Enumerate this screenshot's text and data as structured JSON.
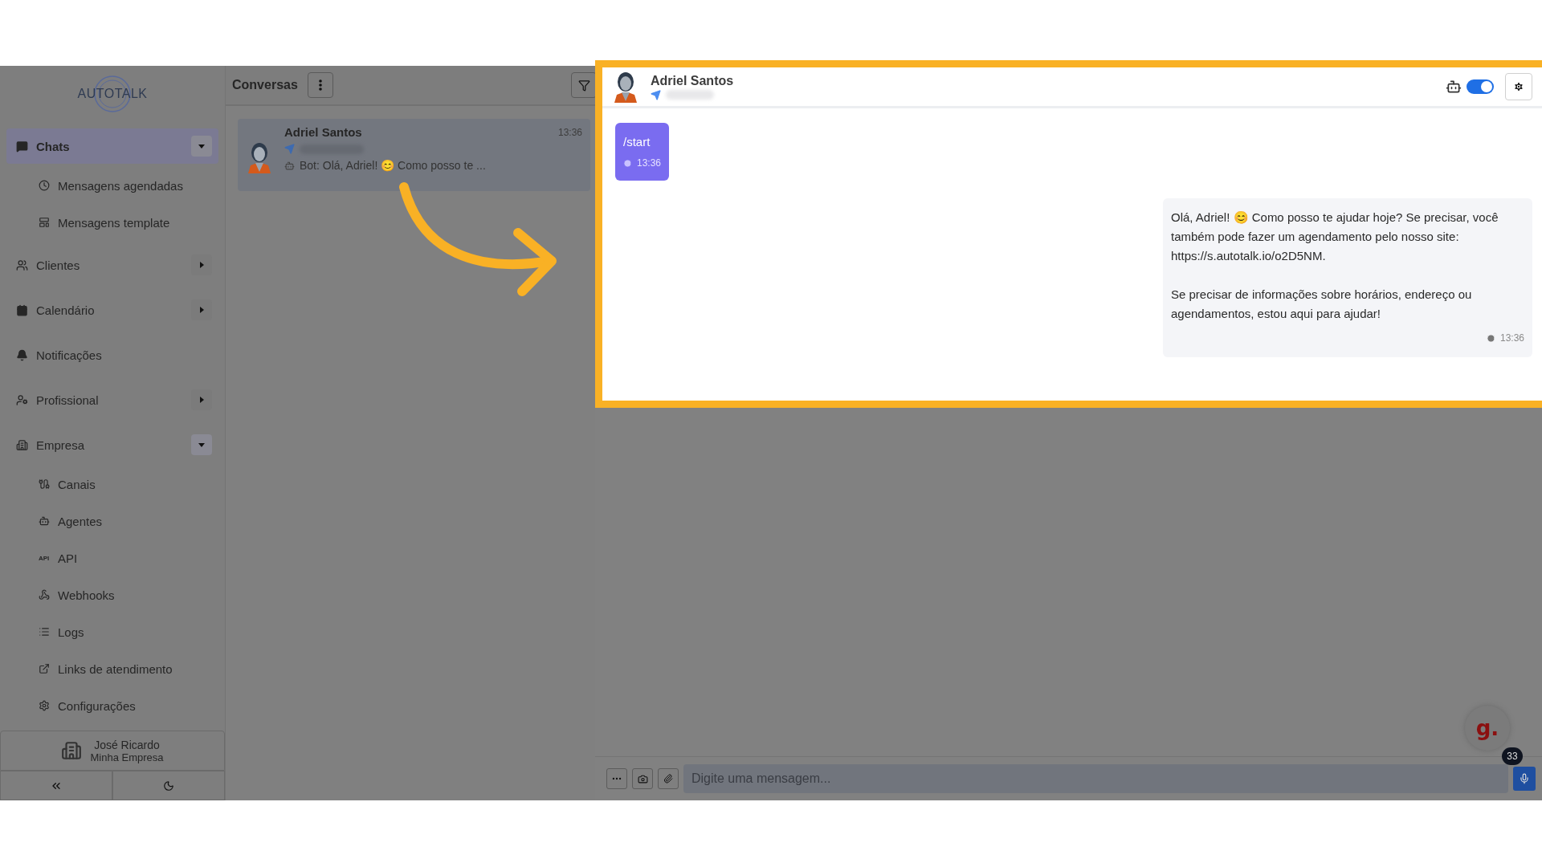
{
  "sidebar": {
    "logo": "AUTOTALK",
    "items": [
      {
        "label": "Chats",
        "selected": true,
        "expanded": true,
        "children": [
          {
            "label": "Mensagens agendadas",
            "selected": false
          },
          {
            "label": "Mensagens template",
            "selected": false
          }
        ]
      },
      {
        "label": "Clientes",
        "selected": false,
        "expanded": false
      },
      {
        "label": "Calendário",
        "selected": false,
        "expanded": false
      },
      {
        "label": "Notificações",
        "selected": false
      },
      {
        "label": "Profissional",
        "selected": false,
        "expanded": false
      },
      {
        "label": "Empresa",
        "selected": false,
        "expanded": true,
        "children": [
          {
            "label": "Canais",
            "selected": false
          },
          {
            "label": "Agentes",
            "selected": false
          },
          {
            "label": "API",
            "selected": false,
            "icon_text": "API"
          },
          {
            "label": "Webhooks",
            "selected": false
          },
          {
            "label": "Logs",
            "selected": false
          },
          {
            "label": "Links de atendimento",
            "selected": false
          },
          {
            "label": "Configurações",
            "selected": false
          }
        ]
      }
    ],
    "user": {
      "name": "José Ricardo",
      "company": "Minha Empresa"
    }
  },
  "conversations": {
    "title": "Conversas",
    "items": [
      {
        "name": "Adriel Santos",
        "time": "13:36",
        "preview": "Bot: Olá, Adriel! 😊 Como posso te ...",
        "selected": true
      }
    ]
  },
  "chat": {
    "contact_name": "Adriel Santos",
    "bot_toggle": {
      "on": true
    },
    "messages": [
      {
        "kind": "incoming",
        "paragraphs": [
          "/start"
        ],
        "time": "13:36"
      },
      {
        "kind": "outgoing",
        "paragraphs": [
          "Olá, Adriel! 😊 Como posso te ajudar hoje? Se precisar, você também pode fazer um agendamento pelo nosso site: https://s.autotalk.io/o2D5NM.",
          "Se precisar de informações sobre horários, endereço ou agendamentos, estou aqui para ajudar!"
        ],
        "time": "13:36"
      }
    ],
    "input": {
      "placeholder": "Digite uma mensagem..."
    },
    "widget": {
      "label": "g.",
      "badge": "33"
    }
  }
}
